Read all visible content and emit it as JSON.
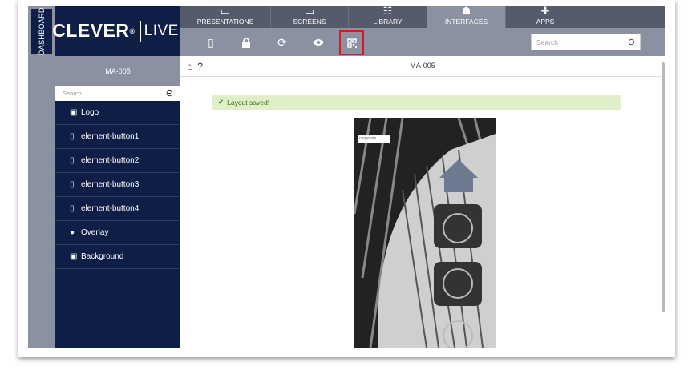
{
  "rail": {
    "label": "DASHBOARD"
  },
  "brand": {
    "name": "CLEVER",
    "reg": "®",
    "live": "LIVE"
  },
  "nav": {
    "tabs": [
      {
        "label": "PRESENTATIONS",
        "icon": "presentation-icon"
      },
      {
        "label": "SCREENS",
        "icon": "monitor-icon"
      },
      {
        "label": "LIBRARY",
        "icon": "library-icon"
      },
      {
        "label": "INTERFACES",
        "icon": "interfaces-icon"
      },
      {
        "label": "APPS",
        "icon": "puzzle-icon"
      }
    ]
  },
  "toolbar": {
    "search_placeholder": "Search"
  },
  "sidebar": {
    "title": "MA-005",
    "search_placeholder": "Search",
    "items": [
      {
        "label": "Logo",
        "icon": "image-icon"
      },
      {
        "label": "element-button1",
        "icon": "button-element-icon"
      },
      {
        "label": "element-button2",
        "icon": "button-element-icon"
      },
      {
        "label": "element-button3",
        "icon": "button-element-icon"
      },
      {
        "label": "element-button4",
        "icon": "button-element-icon"
      },
      {
        "label": "Overlay",
        "icon": "overlay-icon"
      },
      {
        "label": "Background",
        "icon": "image-icon"
      }
    ]
  },
  "main": {
    "title": "MA-005",
    "alert": "Layout saved!",
    "preview_logo": "corporate"
  },
  "colors": {
    "navy": "#0f1e46",
    "slate": "#8b91a1",
    "dark_nav": "#555b6b",
    "alert_bg": "#dff0c8",
    "alert_text": "#3c6b1a",
    "highlight": "#e0141e"
  }
}
